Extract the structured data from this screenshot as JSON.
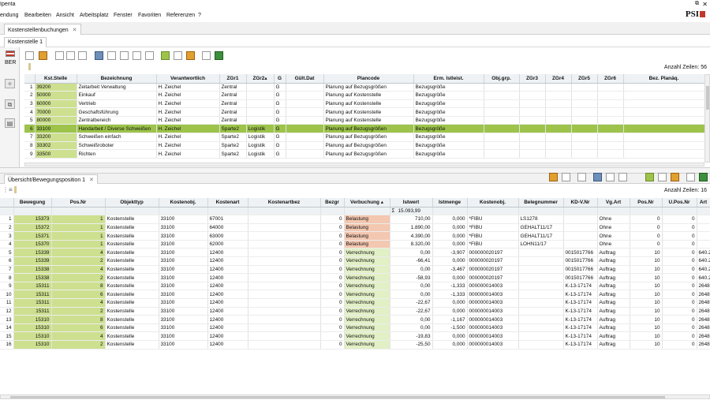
{
  "window": {
    "title": "Ipenta",
    "restore_glyph": "⧉",
    "close_glyph": "✕"
  },
  "menu": [
    "endung",
    "Bearbeiten",
    "Ansicht",
    "Arbeitsplatz",
    "Fenster",
    "Favoriten",
    "Referenzen",
    "?"
  ],
  "brand": "PSI",
  "tabs": {
    "main": "Kostenstellenbuchungen",
    "sub": "Kostenstelle 1",
    "lower": "Übersicht/Bewegungsposition 1",
    "close_glyph": "✕"
  },
  "left": {
    "label": "BER"
  },
  "upper": {
    "count_label": "Anzahl Zeilen: 56",
    "headers": [
      "",
      "Kst.Stelle",
      "Bezeichnung",
      "Verantwortlich",
      "ZGr1",
      "ZGr2▴",
      "G",
      "Gült.Dat",
      "Plancode",
      "Erm. Istleist.",
      "Obj.grp.",
      "ZGr3",
      "ZGr4",
      "ZGr5",
      "ZGr6",
      "Bez. Planäq."
    ],
    "rows": [
      [
        "1",
        "39200",
        "Zeitarbeit Verwaltung",
        "H. Zeichel",
        "Zentral",
        "",
        "G",
        "",
        "Planung auf Bezugsgrößen",
        "Bezugsgröße",
        "",
        "",
        "",
        "",
        "",
        ""
      ],
      [
        "2",
        "50000",
        "Einkauf",
        "H. Zeichel",
        "Zentral",
        "",
        "G",
        "",
        "Planung auf Kostenstelle",
        "Bezugsgröße",
        "",
        "",
        "",
        "",
        "",
        ""
      ],
      [
        "3",
        "60000",
        "Vertrieb",
        "H. Zeichel",
        "Zentral",
        "",
        "G",
        "",
        "Planung auf Kostenstelle",
        "Bezugsgröße",
        "",
        "",
        "",
        "",
        "",
        ""
      ],
      [
        "4",
        "70000",
        "Geschaftsführung",
        "H. Zeichel",
        "Zentral",
        "",
        "G",
        "",
        "Planung auf Kostenstelle",
        "Bezugsgröße",
        "",
        "",
        "",
        "",
        "",
        ""
      ],
      [
        "5",
        "80000",
        "Zentralbereich",
        "H. Zeichel",
        "Zentral",
        "",
        "G",
        "",
        "Planung auf Kostenstelle",
        "Bezugsgröße",
        "",
        "",
        "",
        "",
        "",
        ""
      ],
      [
        "6",
        "33100",
        "Handarbeit / Diverse Schweißen",
        "H. Zeichel",
        "Sparte2",
        "Logistik",
        "G",
        "",
        "Planung auf Bezugsgrößen",
        "Bezugsgröße",
        "",
        "",
        "",
        "",
        "",
        ""
      ],
      [
        "7",
        "33200",
        "Schweißen einfach",
        "H. Zeichel",
        "Sparte2",
        "Logistik",
        "G",
        "",
        "Planung auf Bezugsgrößen",
        "Bezugsgröße",
        "",
        "",
        "",
        "",
        "",
        ""
      ],
      [
        "8",
        "33302",
        "Schweißroboter",
        "H. Zeichel",
        "Sparte2",
        "Logistik",
        "G",
        "",
        "Planung auf Bezugsgrößen",
        "Bezugsgröße",
        "",
        "",
        "",
        "",
        "",
        ""
      ],
      [
        "9",
        "33500",
        "Richten",
        "H. Zeichel",
        "Sparte2",
        "Logistik",
        "G",
        "",
        "Planung auf Bezugsgrößen",
        "Bezugsgröße",
        "",
        "",
        "",
        "",
        "",
        ""
      ]
    ],
    "selected_row": 5
  },
  "lower": {
    "count_label": "Anzahl Zeilen: 16",
    "headers": [
      "",
      "Bewegung",
      "Pos.Nr",
      "Objekttyp",
      "Kostenobj.",
      "Kostenart",
      "Kostenartbez",
      "Bezgr",
      "Verbuchung ▴",
      "Istwert",
      "Istmenge",
      "Kostenobj.",
      "Belegnummer",
      "KD-V.Nr",
      "Vg.Art",
      "Pos.Nr",
      "U.Pos.Nr",
      "Art"
    ],
    "sum_symbol": "Σ",
    "sum_value": "15.093,99",
    "rows": [
      [
        "1",
        "15373",
        "1",
        "Kostenstelle",
        "33100",
        "67001",
        "",
        "0",
        "Belastung",
        "710,00",
        "0,000",
        "*FIBU",
        "LS1278",
        "",
        "Ohne",
        "0",
        "0",
        ""
      ],
      [
        "2",
        "15372",
        "1",
        "Kostenstelle",
        "33100",
        "64000",
        "",
        "0",
        "Belastung",
        "1.890,00",
        "0,000",
        "*FIBU",
        "GEHALT11/17",
        "",
        "Ohne",
        "0",
        "0",
        ""
      ],
      [
        "3",
        "15371",
        "1",
        "Kostenstelle",
        "33100",
        "63000",
        "",
        "0",
        "Belastung",
        "4.390,00",
        "0,000",
        "*FIBU",
        "GEHALT11/17",
        "",
        "Ohne",
        "0",
        "0",
        ""
      ],
      [
        "4",
        "15370",
        "1",
        "Kostenstelle",
        "33100",
        "62000",
        "",
        "0",
        "Belastung",
        "8.320,00",
        "0,000",
        "*FIBU",
        "LOHN11/17",
        "",
        "Ohne",
        "0",
        "0",
        ""
      ],
      [
        "5",
        "15339",
        "4",
        "Kostenstelle",
        "33100",
        "12400",
        "",
        "0",
        "Verrechnung",
        "0,00",
        "-3,907",
        "000000020197",
        "",
        "0015017766",
        "Auftrag",
        "10",
        "0",
        "640.227"
      ],
      [
        "6",
        "15339",
        "2",
        "Kostenstelle",
        "33100",
        "12400",
        "",
        "0",
        "Verrechnung",
        "-66,41",
        "0,000",
        "000000020197",
        "",
        "0015017766",
        "Auftrag",
        "10",
        "0",
        "640.227"
      ],
      [
        "7",
        "15338",
        "4",
        "Kostenstelle",
        "33100",
        "12400",
        "",
        "0",
        "Verrechnung",
        "0,00",
        "-3,467",
        "000000020197",
        "",
        "0015017766",
        "Auftrag",
        "10",
        "0",
        "640.227"
      ],
      [
        "8",
        "15338",
        "2",
        "Kostenstelle",
        "33100",
        "12400",
        "",
        "0",
        "Verrechnung",
        "-58,93",
        "0,000",
        "000000020197",
        "",
        "0015017766",
        "Auftrag",
        "10",
        "0",
        "640.227"
      ],
      [
        "9",
        "15311",
        "8",
        "Kostenstelle",
        "33100",
        "12400",
        "",
        "0",
        "Verrechnung",
        "0,00",
        "-1,333",
        "000000014003",
        "",
        "K-13-17174",
        "Auftrag",
        "10",
        "0",
        "2648"
      ],
      [
        "10",
        "15311",
        "6",
        "Kostenstelle",
        "33100",
        "12400",
        "",
        "0",
        "Verrechnung",
        "0,00",
        "-1,333",
        "000000014003",
        "",
        "K-13-17174",
        "Auftrag",
        "10",
        "0",
        "2648"
      ],
      [
        "11",
        "15311",
        "4",
        "Kostenstelle",
        "33100",
        "12400",
        "",
        "0",
        "Verrechnung",
        "-22,67",
        "0,000",
        "000000014003",
        "",
        "K-13-17174",
        "Auftrag",
        "10",
        "0",
        "2648"
      ],
      [
        "12",
        "15311",
        "2",
        "Kostenstelle",
        "33100",
        "12400",
        "",
        "0",
        "Verrechnung",
        "-22,67",
        "0,000",
        "000000014003",
        "",
        "K-13-17174",
        "Auftrag",
        "10",
        "0",
        "2648"
      ],
      [
        "13",
        "15310",
        "8",
        "Kostenstelle",
        "33100",
        "12400",
        "",
        "0",
        "Verrechnung",
        "0,00",
        "-1,167",
        "000000014003",
        "",
        "K-13-17174",
        "Auftrag",
        "10",
        "0",
        "2648"
      ],
      [
        "14",
        "15310",
        "6",
        "Kostenstelle",
        "33100",
        "12400",
        "",
        "0",
        "Verrechnung",
        "0,00",
        "-1,500",
        "000000014003",
        "",
        "K-13-17174",
        "Auftrag",
        "10",
        "0",
        "2648"
      ],
      [
        "15",
        "15310",
        "4",
        "Kostenstelle",
        "33100",
        "12400",
        "",
        "0",
        "Verrechnung",
        "-19,83",
        "0,000",
        "000000014003",
        "",
        "K-13-17174",
        "Auftrag",
        "10",
        "0",
        "2648"
      ],
      [
        "16",
        "15310",
        "2",
        "Kostenstelle",
        "33100",
        "12400",
        "",
        "0",
        "Verrechnung",
        "-25,50",
        "0,000",
        "000000014003",
        "",
        "K-13-17174",
        "Auftrag",
        "10",
        "0",
        "2648"
      ]
    ]
  }
}
